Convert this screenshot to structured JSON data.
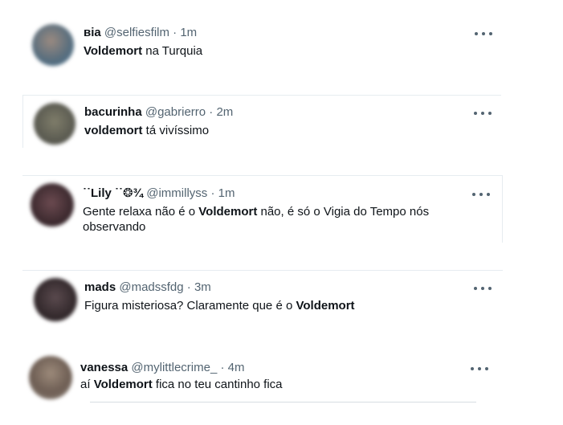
{
  "tweets": [
    {
      "name": "вia",
      "handle": "@selfiesfilm",
      "dot": "·",
      "time": "1m",
      "text_before": "",
      "text_bold": "Voldemort",
      "text_after": " na Turquia",
      "avatar_color": "#7a6a63"
    },
    {
      "name": "bacurinha",
      "handle": "@gabrierro",
      "dot": "·",
      "time": "2m",
      "text_before": "",
      "text_bold": "voldemort",
      "text_after": " tá vivíssimo",
      "avatar_color": "#6e6e5e"
    },
    {
      "name": "˙˙Lily ˙˙❂¾",
      "handle": "@immillyss",
      "dot": "·",
      "time": "1m",
      "text_line1_before": "Gente relaxa não é o ",
      "text_line1_bold": "Voldemort",
      "text_line1_after": " não, é só o Vigia do Tempo nós",
      "text_line2": "observando",
      "avatar_color": "#4a2f33"
    },
    {
      "name": "mads",
      "handle": "@madssfdg",
      "dot": "·",
      "time": "3m",
      "text_before": "Figura misteriosa? Claramente que é o ",
      "text_bold": "Voldemort",
      "text_after": "",
      "avatar_color": "#3b3336"
    },
    {
      "name": "vanessa",
      "handle": "@mylittlecrime_",
      "dot": "·",
      "time": "4m",
      "text_before": "aí ",
      "text_bold": "Voldemort",
      "text_after": " fica no teu cantinho fica",
      "avatar_color": "#8a7a6c"
    }
  ]
}
